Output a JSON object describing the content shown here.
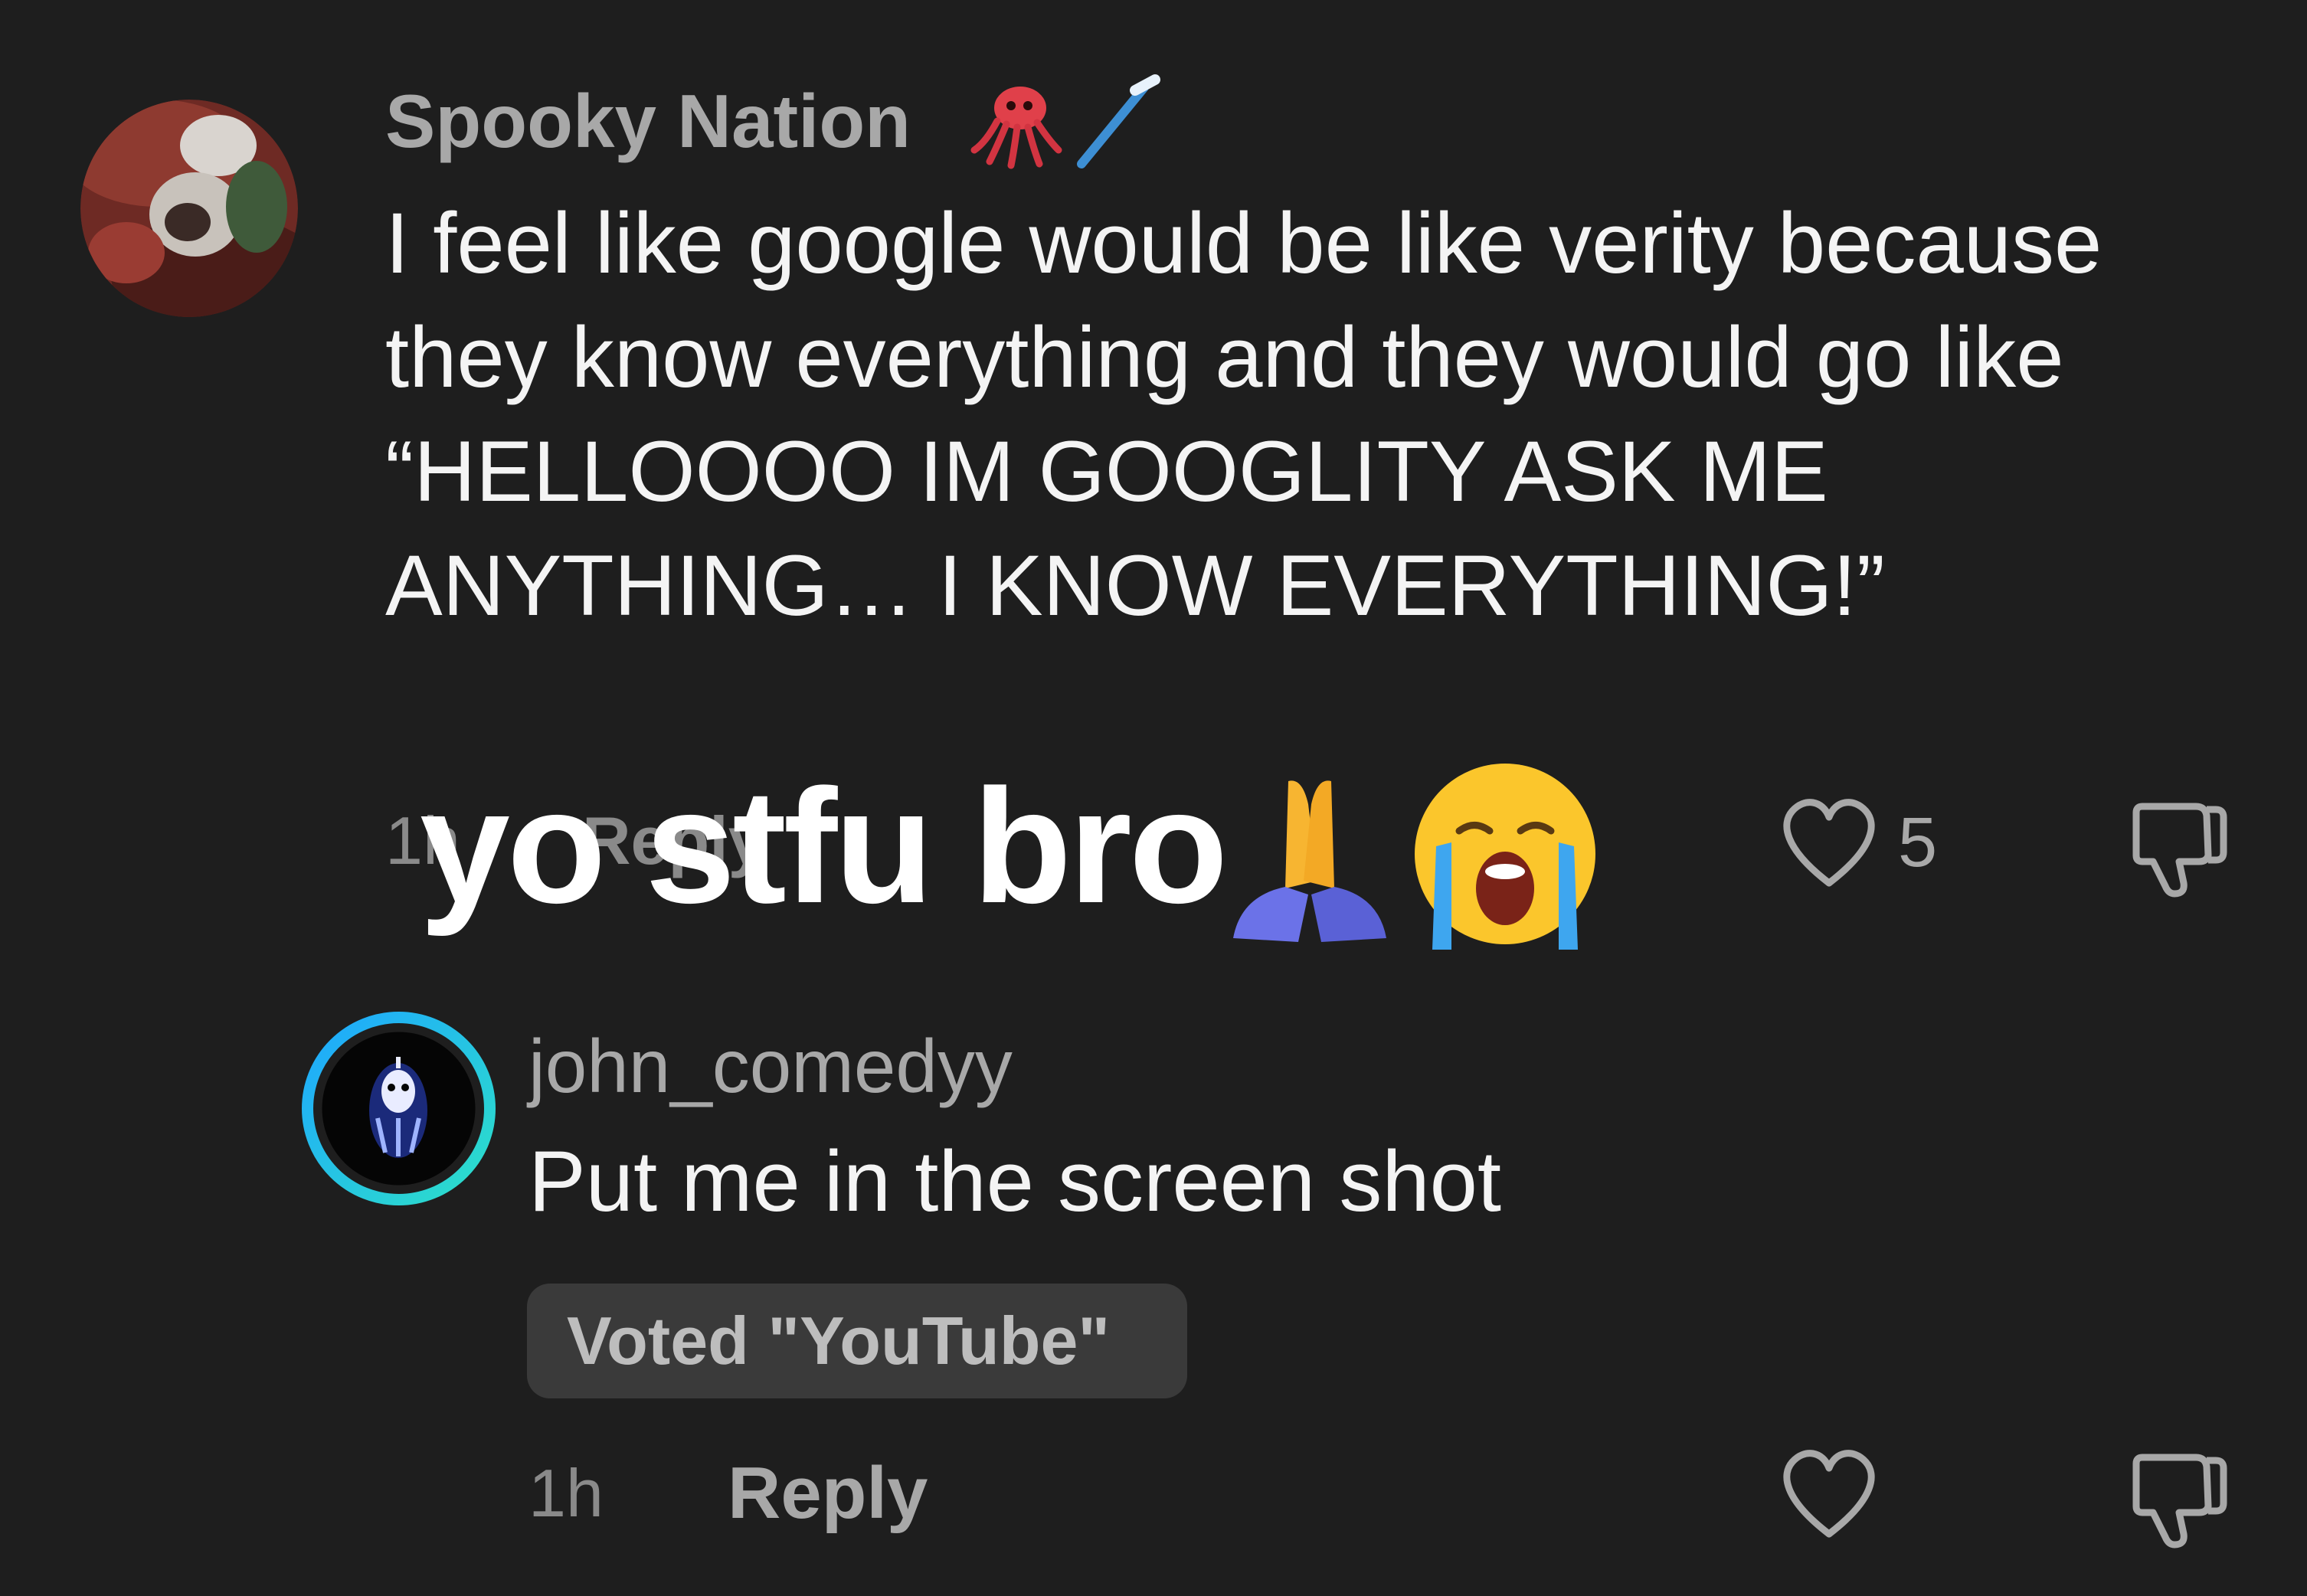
{
  "comments": [
    {
      "username": "Spooky Nation",
      "username_icons": [
        "squid-emoji",
        "toothbrush-emoji"
      ],
      "text": "I feel like google would be like verity because they know everything and they would go like “HELLOOOO IM GOOGLITY ASK ME ANYTHING… I KNOW EVERYTHING!”",
      "time": "1h",
      "reply_label": "Reply",
      "like_count": "5"
    },
    {
      "username": "john_comedyy",
      "text": "Put me in the screen shot",
      "vote_badge": "Voted \"YouTube\"",
      "time": "1h",
      "reply_label": "Reply"
    }
  ],
  "overlay": {
    "text": "yo stfu bro",
    "emojis": [
      "folded-hands-emoji",
      "loudly-crying-face-emoji"
    ]
  },
  "colors": {
    "background": "#1e1e1e",
    "primary_text": "#f4f4f4",
    "secondary_text": "#a8a8a8",
    "badge_bg": "#3a3a3a",
    "story_ring_start": "#1ea7ff",
    "story_ring_end": "#2de0c8"
  }
}
